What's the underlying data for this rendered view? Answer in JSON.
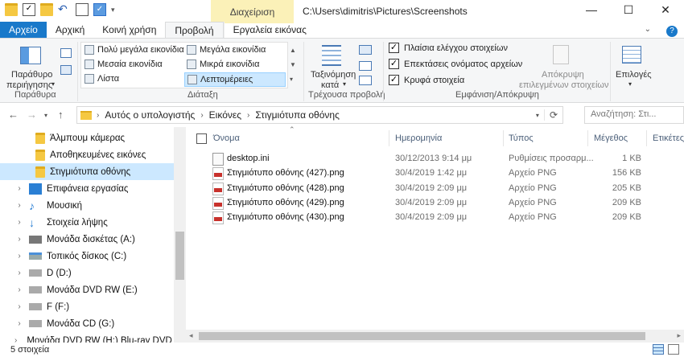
{
  "titlebar": {
    "manage_tab": "Διαχείριση",
    "path": "C:\\Users\\dimitris\\Pictures\\Screenshots",
    "minimize": "—",
    "maximize": "☐",
    "close": "✕"
  },
  "tabs": [
    "Αρχείο",
    "Αρχική",
    "Κοινή χρήση",
    "Προβολή",
    "Εργαλεία εικόνας"
  ],
  "ribbon": {
    "panes": {
      "preview_pane": "Παράθυρο",
      "preview_pane2": "περιήγησης",
      "label": "Παράθυρα"
    },
    "layout": {
      "label": "Διάταξη",
      "items": [
        "Πολύ μεγάλα εικονίδια",
        "Μεγάλα εικονίδια",
        "Μεσαία εικονίδια",
        "Μικρά εικονίδια",
        "Λίστα",
        "Λεπτομέρειες"
      ]
    },
    "current_view": {
      "sort1": "Ταξινόμηση",
      "sort2": "κατά",
      "label": "Τρέχουσα προβολή"
    },
    "show_hide": {
      "checkboxes": [
        "Πλαίσια ελέγχου στοιχείων",
        "Επεκτάσεις ονόματος αρχείων",
        "Κρυφά στοιχεία"
      ],
      "hide_selected1": "Απόκρυψη",
      "hide_selected2": "επιλεγμένων στοιχείων",
      "label": "Εμφάνιση/Απόκρυψη"
    },
    "options": "Επιλογές"
  },
  "address": {
    "crumbs": [
      "Αυτός ο υπολογιστής",
      "Εικόνες",
      "Στιγμιότυπα οθόνης"
    ],
    "search_placeholder": "Αναζήτηση: Στι..."
  },
  "nav": [
    {
      "label": "Άλμπουμ κάμερας"
    },
    {
      "label": "Αποθηκευμένες εικόνες"
    },
    {
      "label": "Στιγμιότυπα οθόνης"
    },
    {
      "label": "Επιφάνεια εργασίας"
    },
    {
      "label": "Μουσική"
    },
    {
      "label": "Στοιχεία λήψης"
    },
    {
      "label": "Μονάδα δισκέτας (A:)"
    },
    {
      "label": "Τοπικός δίσκος (C:)"
    },
    {
      "label": "D (D:)"
    },
    {
      "label": "Μονάδα DVD RW (E:)"
    },
    {
      "label": "F (F:)"
    },
    {
      "label": "Μονάδα CD (G:)"
    },
    {
      "label": "Μονάδα DVD RW (H:) Blu-ray DVD (Y:) BD"
    }
  ],
  "columns": [
    "Όνομα",
    "Ημερομηνία",
    "Τύπος",
    "Μέγεθος",
    "Ετικέτες"
  ],
  "files": [
    {
      "name": "desktop.ini",
      "date": "30/12/2013 9:14 μμ",
      "type": "Ρυθμίσεις προσαρμ...",
      "size": "1 KB"
    },
    {
      "name": "Στιγμιότυπο οθόνης (427).png",
      "date": "30/4/2019 1:42 μμ",
      "type": "Αρχείο PNG",
      "size": "156 KB"
    },
    {
      "name": "Στιγμιότυπο οθόνης (428).png",
      "date": "30/4/2019 2:09 μμ",
      "type": "Αρχείο PNG",
      "size": "205 KB"
    },
    {
      "name": "Στιγμιότυπο οθόνης (429).png",
      "date": "30/4/2019 2:09 μμ",
      "type": "Αρχείο PNG",
      "size": "209 KB"
    },
    {
      "name": "Στιγμιότυπο οθόνης (430).png",
      "date": "30/4/2019 2:09 μμ",
      "type": "Αρχείο PNG",
      "size": "209 KB"
    }
  ],
  "status": "5 στοιχεία"
}
